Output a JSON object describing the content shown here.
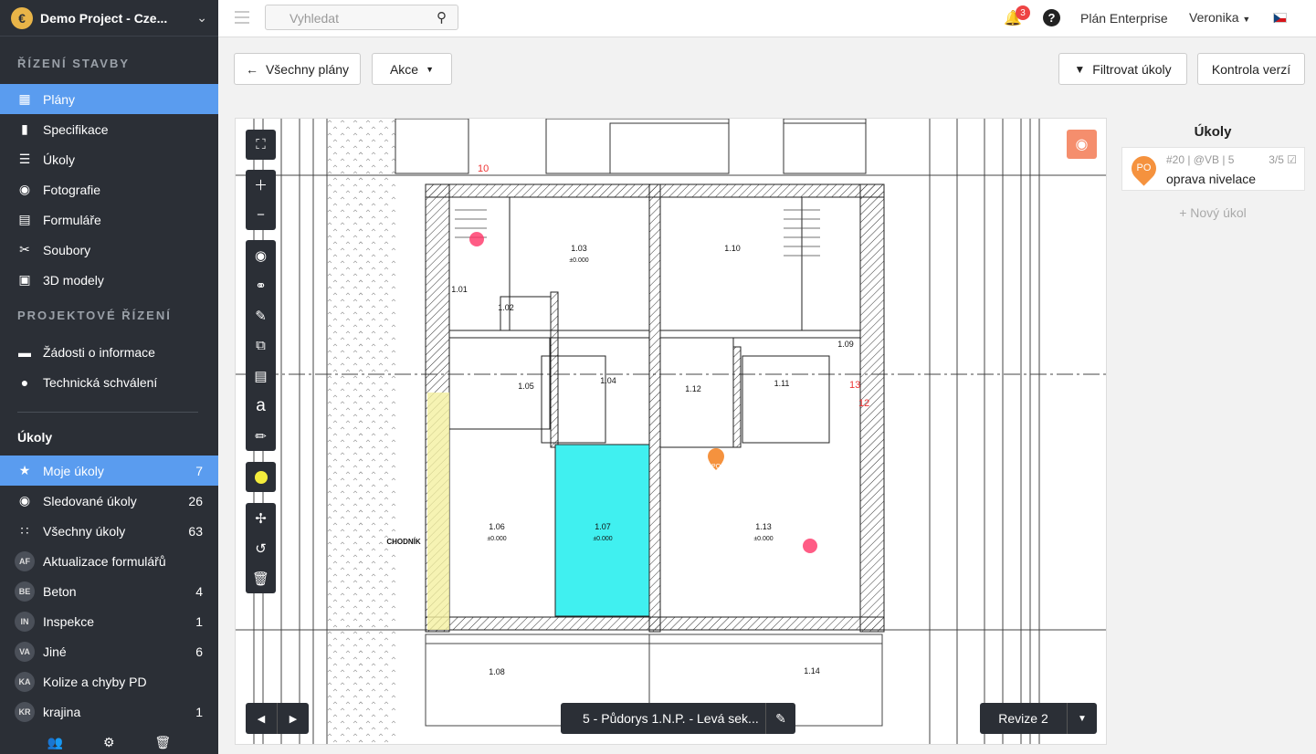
{
  "sidebar": {
    "project_name": "Demo Project - Cze...",
    "logo_letter": "€",
    "section1": "ŘÍZENÍ STAVBY",
    "nav1": [
      {
        "label": "Plány",
        "icon": "plans-icon",
        "active": true
      },
      {
        "label": "Specifikace",
        "icon": "book-icon"
      },
      {
        "label": "Úkoly",
        "icon": "list-icon"
      },
      {
        "label": "Fotografie",
        "icon": "camera-icon"
      },
      {
        "label": "Formuláře",
        "icon": "clipboard-icon"
      },
      {
        "label": "Soubory",
        "icon": "paperclip-icon"
      },
      {
        "label": "3D modely",
        "icon": "cube-icon"
      }
    ],
    "section2": "PROJEKTOVÉ ŘÍZENÍ",
    "nav2": [
      {
        "label": "Žádosti o informace",
        "icon": "info-file-icon"
      },
      {
        "label": "Technická schválení",
        "icon": "user-icon"
      }
    ],
    "tasks_title": "Úkoly",
    "tasks": [
      {
        "label": "Moje úkoly",
        "count": "7",
        "icon": "star-icon",
        "active": true
      },
      {
        "label": "Sledované úkoly",
        "count": "26",
        "icon": "eye-icon"
      },
      {
        "label": "Všechny úkoly",
        "count": "63",
        "icon": "grid-icon"
      },
      {
        "label": "Aktualizace formulářů",
        "count": "",
        "abbr": "AF"
      },
      {
        "label": "Beton",
        "count": "4",
        "abbr": "BE"
      },
      {
        "label": "Inspekce",
        "count": "1",
        "abbr": "IN"
      },
      {
        "label": "Jiné",
        "count": "6",
        "abbr": "VA"
      },
      {
        "label": "Kolize a chyby PD",
        "count": "",
        "abbr": "KA"
      },
      {
        "label": "krajina",
        "count": "1",
        "abbr": "KR"
      }
    ]
  },
  "topbar": {
    "search_placeholder": "Vyhledat",
    "notifications": "3",
    "plan": "Plán Enterprise",
    "user": "Veronika"
  },
  "toolbar": {
    "all_plans": "Všechny plány",
    "actions": "Akce",
    "filter": "Filtrovat úkoly",
    "version": "Kontrola verzí"
  },
  "plan": {
    "sheet": "5 - Půdorys 1.N.P. - Levá sek...",
    "revision": "Revize 2",
    "rooms": [
      {
        "id": "1.01"
      },
      {
        "id": "1.02"
      },
      {
        "id": "1.03"
      },
      {
        "id": "1.04"
      },
      {
        "id": "1.05"
      },
      {
        "id": "1.06"
      },
      {
        "id": "1.07"
      },
      {
        "id": "1.08"
      },
      {
        "id": "1.09"
      },
      {
        "id": "1.10"
      },
      {
        "id": "1.11"
      },
      {
        "id": "1.12"
      },
      {
        "id": "1.13"
      },
      {
        "id": "1.14"
      }
    ],
    "elevation": "±0.000",
    "chodnik": "CHODNÍK",
    "pin_label": "PO",
    "markers": [
      "10",
      "13",
      "12"
    ]
  },
  "tasks_panel": {
    "title": "Úkoly",
    "task": {
      "meta": "#20 | @VB | 5",
      "count": "3/5",
      "name": "oprava nivelace",
      "avatar": "PO"
    },
    "new_task": "+ Nový úkol"
  },
  "colors": {
    "accent": "#5a9cef",
    "sidebar": "#2b2f36",
    "highlight": "#40f0f0",
    "pin": "#f5923e",
    "eye": "#f58e6d"
  }
}
